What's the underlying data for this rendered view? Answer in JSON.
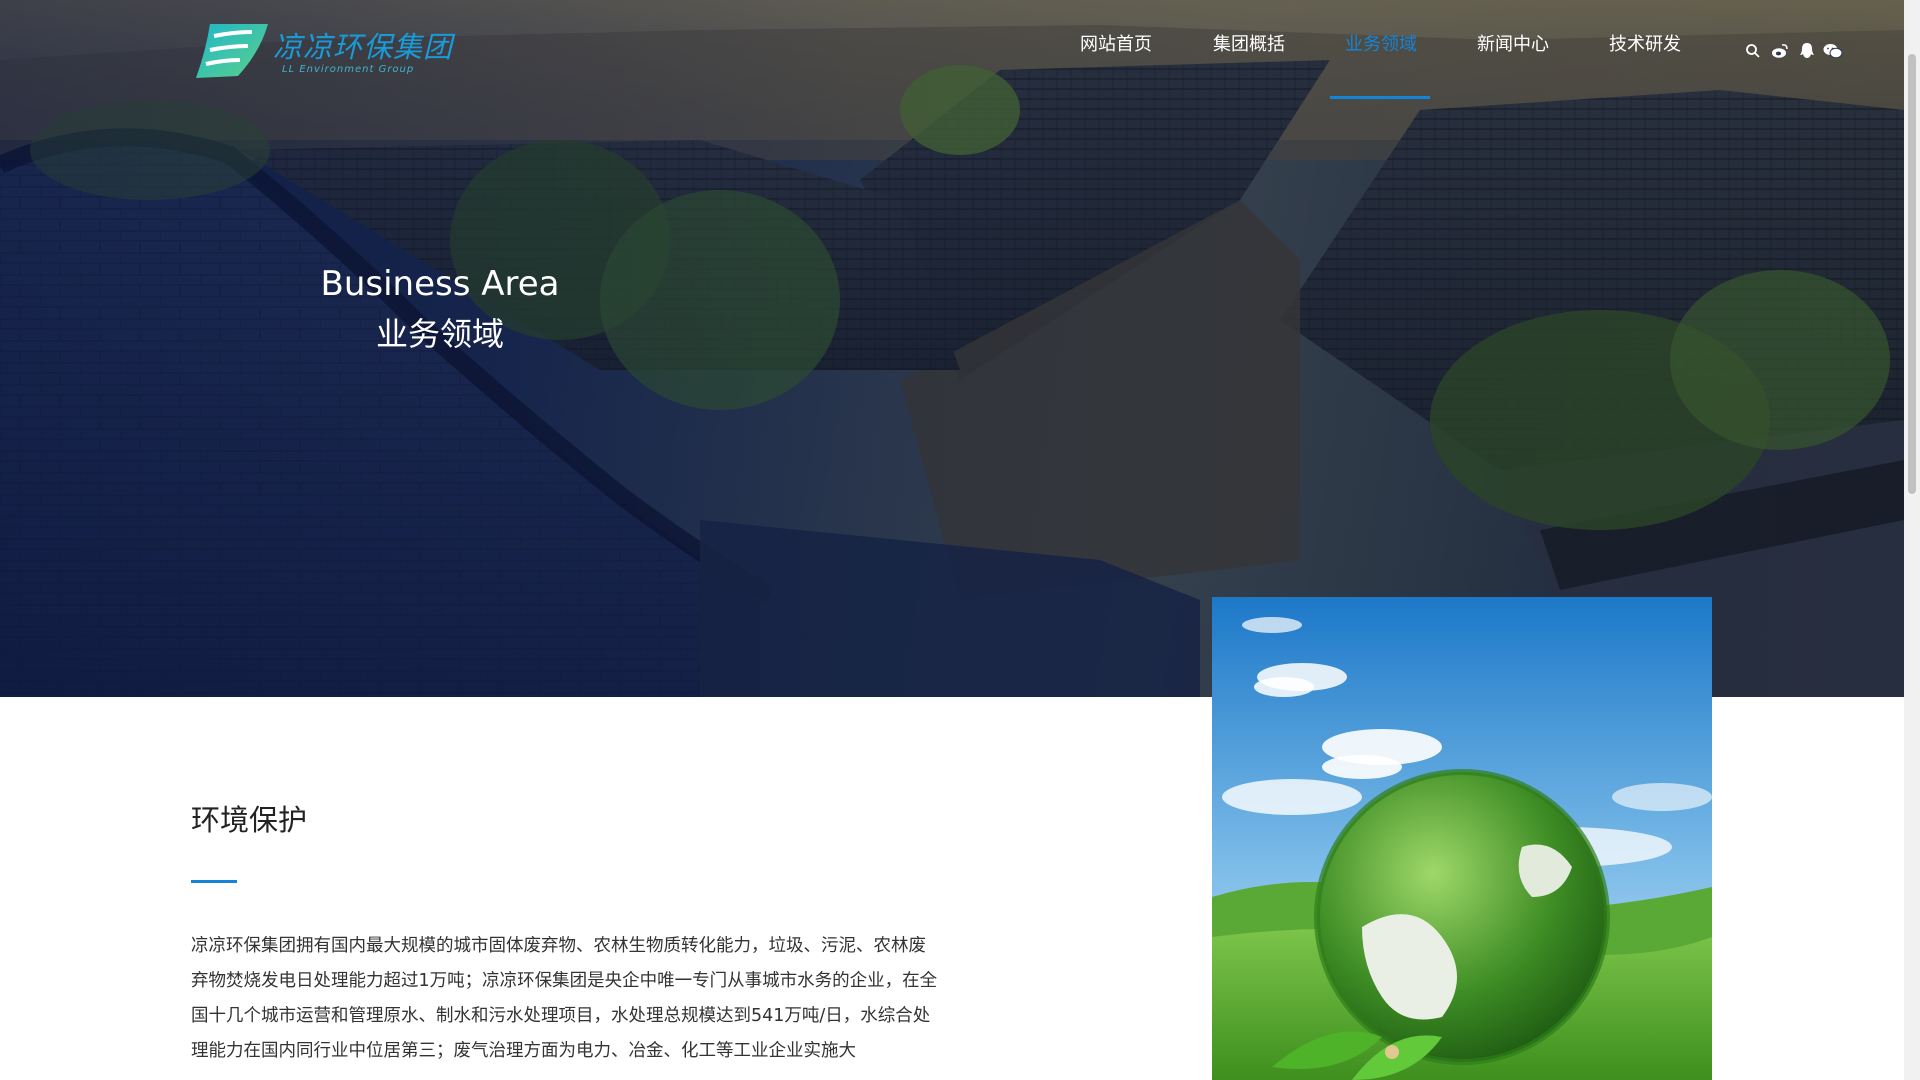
{
  "logo": {
    "name": "凉凉环保集团",
    "subtitle": "LL Environment Group"
  },
  "nav": {
    "items": [
      {
        "label": "网站首页",
        "active": false
      },
      {
        "label": "集团概括",
        "active": false
      },
      {
        "label": "业务领域",
        "active": true
      },
      {
        "label": "新闻中心",
        "active": false
      },
      {
        "label": "技术研发",
        "active": false
      }
    ],
    "icons": [
      "search-icon",
      "weibo-icon",
      "qq-icon",
      "wechat-icon"
    ]
  },
  "banner": {
    "title_en": "Business Area",
    "title_zh": "业务领域"
  },
  "section": {
    "title": "环境保护",
    "text": "凉凉环保集团拥有国内最大规模的城市固体废弃物、农林生物质转化能力，垃圾、污泥、农林废弃物焚烧发电日处理能力超过1万吨；凉凉环保集团是央企中唯一专门从事城市水务的企业，在全国十几个城市运营和管理原水、制水和污水处理项目，水处理总规模达到541万吨/日，水综合处理能力在国内同行业中位居第三；废气治理方面为电力、冶金、化工等工业企业实施大"
  },
  "colors": {
    "accent": "#1583d6",
    "logo": "#1a9ad6",
    "text": "#333333"
  }
}
